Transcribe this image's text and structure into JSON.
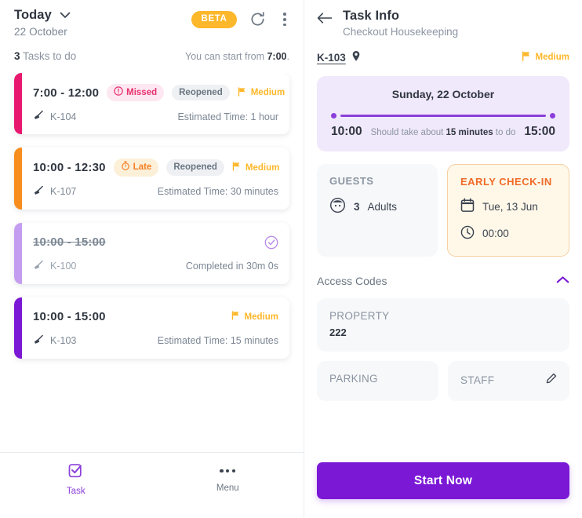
{
  "left_panel": {
    "header": {
      "title": "Today",
      "date": "22 October",
      "beta_label": "BETA",
      "refresh_icon": "refresh-icon",
      "more_icon": "kebab-menu-icon",
      "chevron_icon": "chevron-down-icon"
    },
    "subhead": {
      "count": "3",
      "count_suffix": " Tasks to do",
      "start_prefix": "You can start from ",
      "start_time": "7:00",
      "start_suffix": "."
    },
    "tasks": [
      {
        "time": "7:00 - 12:00",
        "accent": "#e8186e",
        "status_badge": "Missed",
        "status_type": "missed",
        "status_icon": "exclamation-circle-icon",
        "reopened": "Reopened",
        "priority": "Medium",
        "unit": "K-104",
        "unit_icon": "broom-icon",
        "meta": "Estimated Time: 1 hour",
        "completed": false
      },
      {
        "time": "10:00 - 12:30",
        "accent": "#f78d1e",
        "status_badge": "Late",
        "status_type": "late",
        "status_icon": "stopwatch-icon",
        "reopened": "Reopened",
        "priority": "Medium",
        "unit": "K-107",
        "unit_icon": "broom-icon",
        "meta": "Estimated Time: 30 minutes",
        "completed": false
      },
      {
        "time": "10:00 - 15:00",
        "accent": "#c49df0",
        "status_badge": "",
        "status_type": "",
        "status_icon": "",
        "reopened": "",
        "priority": "",
        "unit": "K-100",
        "unit_icon": "broom-icon",
        "meta": "Completed in 30m 0s",
        "completed": true,
        "done_icon": "check-circle-icon"
      },
      {
        "time": "10:00 - 15:00",
        "accent": "#7a18d6",
        "status_badge": "",
        "status_type": "",
        "status_icon": "",
        "reopened": "",
        "priority": "Medium",
        "unit": "K-103",
        "unit_icon": "broom-icon",
        "meta": "Estimated Time: 15 minutes",
        "completed": false
      }
    ],
    "bottom_nav": [
      {
        "label": "Task",
        "icon": "checklist-icon",
        "active": true
      },
      {
        "label": "Menu",
        "icon": "ellipsis-icon",
        "active": false
      }
    ]
  },
  "right_panel": {
    "header": {
      "back_icon": "back-arrow-icon",
      "title": "Task Info",
      "subtitle": "Checkout Housekeeping"
    },
    "meta": {
      "unit": "K-103",
      "pin_icon": "map-pin-icon",
      "priority": "Medium",
      "flag_icon": "flag-icon"
    },
    "timeline": {
      "date": "Sunday, 22 October",
      "start": "10:00",
      "end": "15:00",
      "duration_prefix": "Should take about ",
      "duration": "15 minutes",
      "duration_suffix": " to do"
    },
    "guests": {
      "heading": "GUESTS",
      "icon": "guest-face-icon",
      "count": "3",
      "type": "Adults"
    },
    "early_checkin": {
      "heading": "EARLY CHECK-IN",
      "date_icon": "calendar-icon",
      "date": "Tue, 13 Jun",
      "time_icon": "clock-icon",
      "time": "00:00"
    },
    "access_codes": {
      "section_title": "Access Codes",
      "collapse_icon": "chevron-up-icon",
      "property": {
        "label": "PROPERTY",
        "value": "222"
      },
      "parking": {
        "label": "PARKING"
      },
      "staff": {
        "label": "STAFF",
        "edit_icon": "pencil-icon"
      }
    },
    "footer": {
      "start_label": "Start Now"
    }
  },
  "colors": {
    "brand_purple": "#7a18d6",
    "accent_yellow": "#fdb72a",
    "missed_pink": "#e8186e",
    "late_orange": "#f78d1e",
    "early_orange": "#f06a27"
  }
}
